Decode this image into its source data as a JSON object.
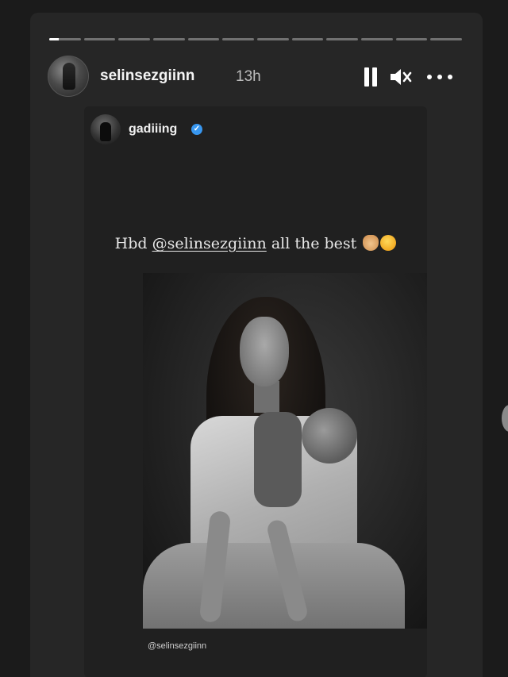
{
  "story": {
    "progress": {
      "segments": 12,
      "active_index": 0,
      "active_fill": 0.3
    },
    "author": {
      "username": "selinsezgiinn",
      "time_ago": "13h"
    },
    "controls": {
      "pause_icon": "pause-icon",
      "mute_icon": "volume-muted-icon",
      "more_icon": "more-horizontal-icon"
    }
  },
  "shared_post": {
    "username": "gadiiing",
    "verified": true,
    "caption": {
      "prefix": "Hbd ",
      "mention": "@selinsezgiinn",
      "suffix": " all the best",
      "emojis": [
        "raised-hands-emoji",
        "hugging-face-emoji"
      ]
    },
    "photo_credit": "@selinsezgiinn"
  },
  "colors": {
    "background": "#1b1b1b",
    "panel": "#262626",
    "verified_blue": "#3897f0"
  }
}
